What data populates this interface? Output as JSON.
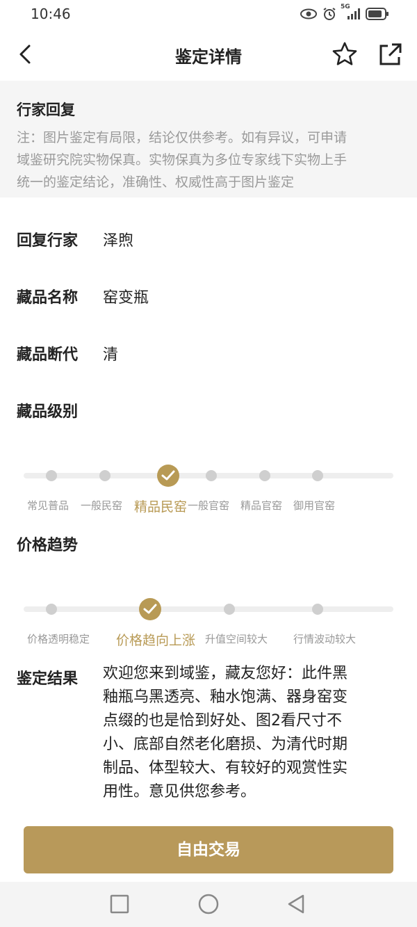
{
  "status_bar": {
    "time": "10:46",
    "network": "5G",
    "icons": [
      "eye-icon",
      "alarm-icon",
      "signal-icon",
      "battery-icon"
    ]
  },
  "header": {
    "title": "鉴定详情",
    "icons": [
      "back-icon",
      "star-icon",
      "share-icon"
    ]
  },
  "notice": {
    "title": "行家回复",
    "lines": [
      "注：图片鉴定有局限，结论仅供参考。如有异议，可申请",
      "域鉴研究院实物保真。实物保真为多位专家线下实物上手",
      "统一的鉴定结论，准确性、权威性高于图片鉴定"
    ]
  },
  "info": {
    "expert_label": "回复行家",
    "expert_value": "泽煦",
    "name_label": "藏品名称",
    "name_value": "窑变瓶",
    "dynasty_label": "藏品断代",
    "dynasty_value": "清"
  },
  "grade": {
    "title": "藏品级别",
    "levels": [
      "常见普品",
      "一般民窑",
      "精品民窑",
      "一般官窑",
      "精品官窑",
      "御用官窑"
    ],
    "selected_index": 2
  },
  "trend": {
    "title": "价格趋势",
    "levels": [
      "价格透明稳定",
      "价格趋向上涨",
      "升值空间较大",
      "行情波动较大"
    ],
    "selected_index": 1
  },
  "result": {
    "label": "鉴定结果",
    "lines": [
      "欢迎您来到域鉴，藏友您好：此件黑",
      "釉瓶乌黑透亮、釉水饱满、器身窑变",
      "点缀的也是恰到好处、图2看尺寸不",
      "小、底部自然老化磨损、为清代时期",
      "制品、体型较大、有较好的观赏性实",
      "用性。意见供您参考。"
    ]
  },
  "actions": {
    "trade_label": "自由交易"
  },
  "colors": {
    "accent": "#b8995a",
    "muted": "#999999",
    "notice_bg": "#f5f5f5"
  },
  "nav_icons": [
    "recent-apps-icon",
    "home-icon",
    "back-nav-icon"
  ]
}
